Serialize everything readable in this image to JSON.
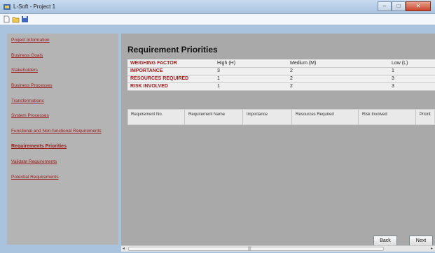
{
  "window": {
    "title": "L-Soft - Project 1",
    "minimize": "–",
    "maximize": "□",
    "close": "✕"
  },
  "toolbar": {
    "icons": [
      "new-file-icon",
      "open-folder-icon",
      "save-icon"
    ]
  },
  "sidebar": {
    "items": [
      {
        "label": "Project Information",
        "active": false
      },
      {
        "label": "Business Goals",
        "active": false
      },
      {
        "label": "Stakeholders",
        "active": false
      },
      {
        "label": "Business Processes",
        "active": false
      },
      {
        "label": "Transformations",
        "active": false
      },
      {
        "label": "System Processes",
        "active": false
      },
      {
        "label": "Functional and Non-functional Requirements",
        "active": false
      },
      {
        "label": "Requirements Priorities",
        "active": true
      },
      {
        "label": "Validate Requirements",
        "active": false
      },
      {
        "label": "Potential Requirements",
        "active": false
      }
    ]
  },
  "main": {
    "title": "Requirement Priorities",
    "weights": {
      "rows": [
        {
          "label": "WEIGHING FACTOR",
          "high": "High (H)",
          "medium": "Medium (M)",
          "low": "Low (L)"
        },
        {
          "label": "IMPORTANCE",
          "high": "3",
          "medium": "2",
          "low": "1"
        },
        {
          "label": "RESOURCES REQUIRED",
          "high": "1",
          "medium": "2",
          "low": "3"
        },
        {
          "label": "RISK INVOLVED",
          "high": "1",
          "medium": "2",
          "low": "3"
        }
      ]
    },
    "grid": {
      "columns": [
        "Requirement No.",
        "Requirement Name",
        "Importance",
        "Resources Required",
        "Risk Involved",
        "Priorit"
      ]
    },
    "buttons": {
      "back": "Back",
      "next": "Next"
    }
  },
  "scrollbar": {
    "left_arrow": "◂",
    "right_arrow": "▸",
    "grip": "|||"
  }
}
